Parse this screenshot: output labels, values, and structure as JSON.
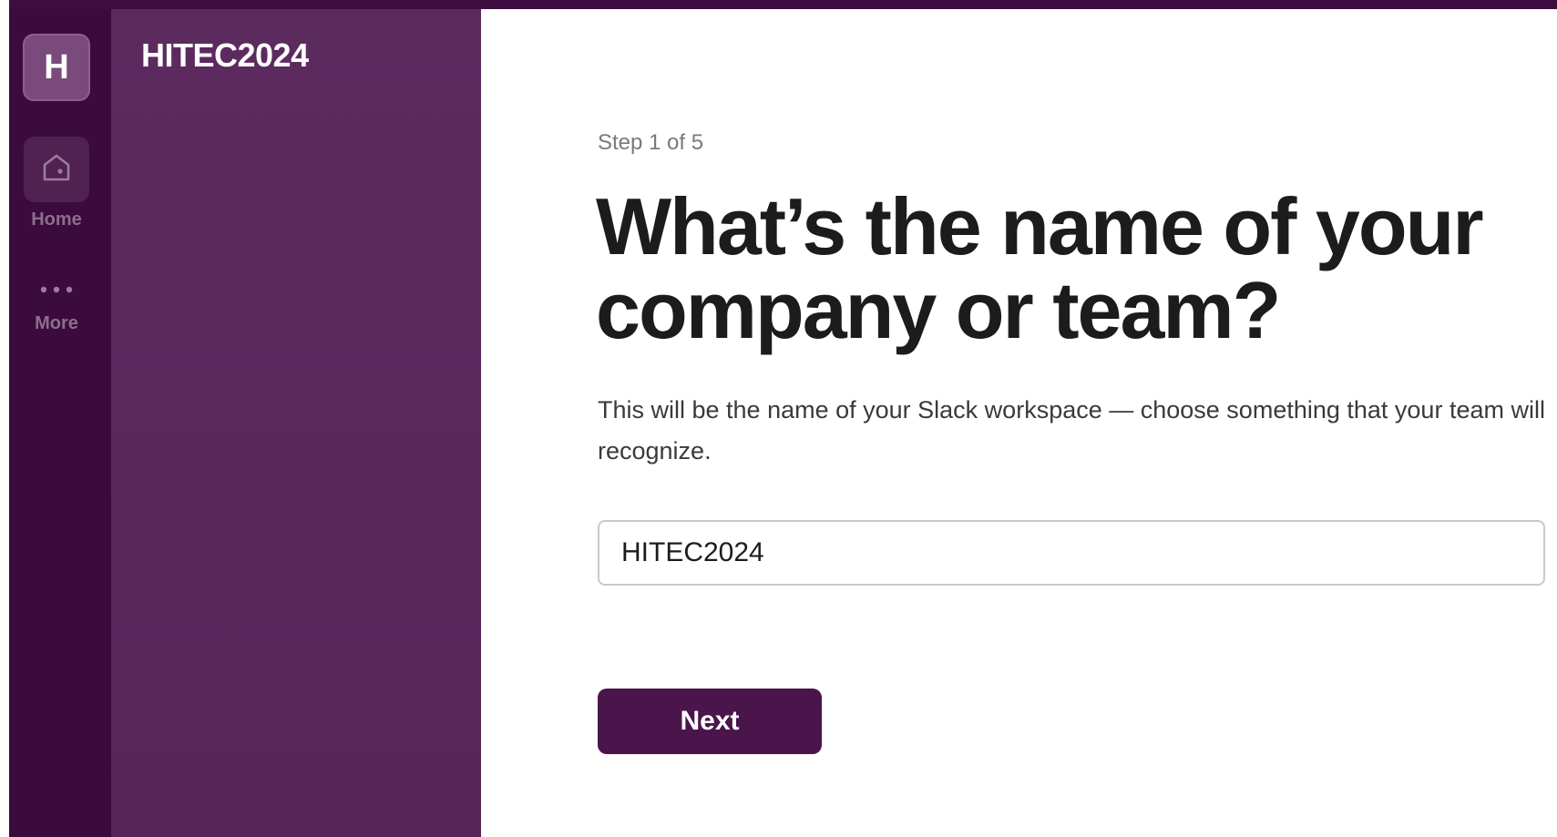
{
  "workspace": {
    "initial": "H",
    "name": "HITEC2024"
  },
  "rail": {
    "home_label": "Home",
    "home_icon": "home-icon",
    "more_label": "More",
    "more_icon": "more-icon"
  },
  "main": {
    "step_text": "Step 1 of 5",
    "heading": "What’s the name of your company or team?",
    "description": "This will be the name of your Slack workspace — choose something that your team will recognize.",
    "input_value": "HITEC2024",
    "next_label": "Next"
  },
  "colors": {
    "top_bar": "#3f0e40",
    "rail_bg": "#3b0b3d",
    "sidebar_bg": "#5c2b5e",
    "primary_button": "#4a154b"
  }
}
